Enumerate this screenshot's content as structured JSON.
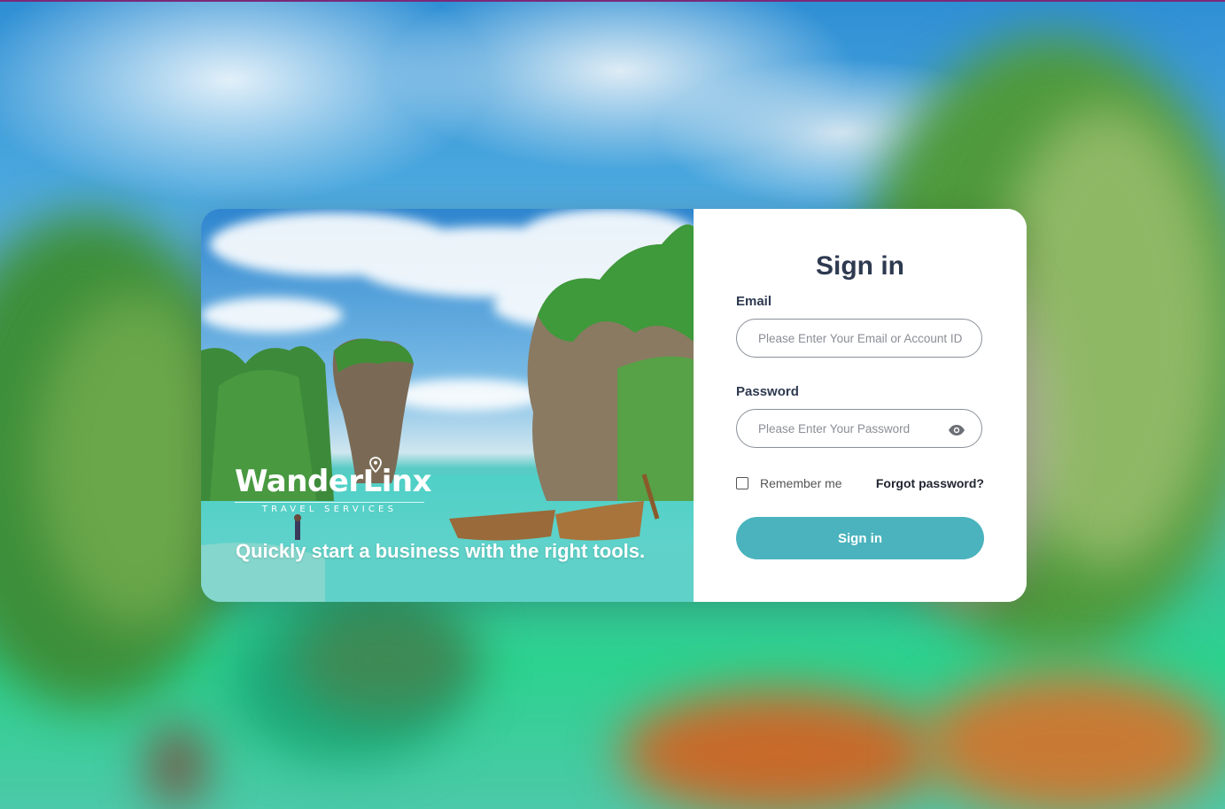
{
  "brand": {
    "logo_word": "WanderLinx",
    "logo_subtitle": "TRAVEL SERVICES",
    "tagline": "Quickly start a business with the right tools."
  },
  "signin": {
    "title": "Sign in",
    "email_label": "Email",
    "email_placeholder": "Please Enter Your Email or Account ID",
    "email_value": "",
    "password_label": "Password",
    "password_placeholder": "Please Enter Your Password",
    "password_value": "",
    "remember_label": "Remember me",
    "remember_checked": false,
    "forgot_label": "Forgot password?",
    "button_label": "Sign in"
  },
  "colors": {
    "accent": "#4ab3bd",
    "title_text": "#2e3a50",
    "top_strip": "#7a2a7a"
  },
  "icons": {
    "password_toggle": "eye-icon",
    "logo_pin": "location-pin-icon"
  }
}
